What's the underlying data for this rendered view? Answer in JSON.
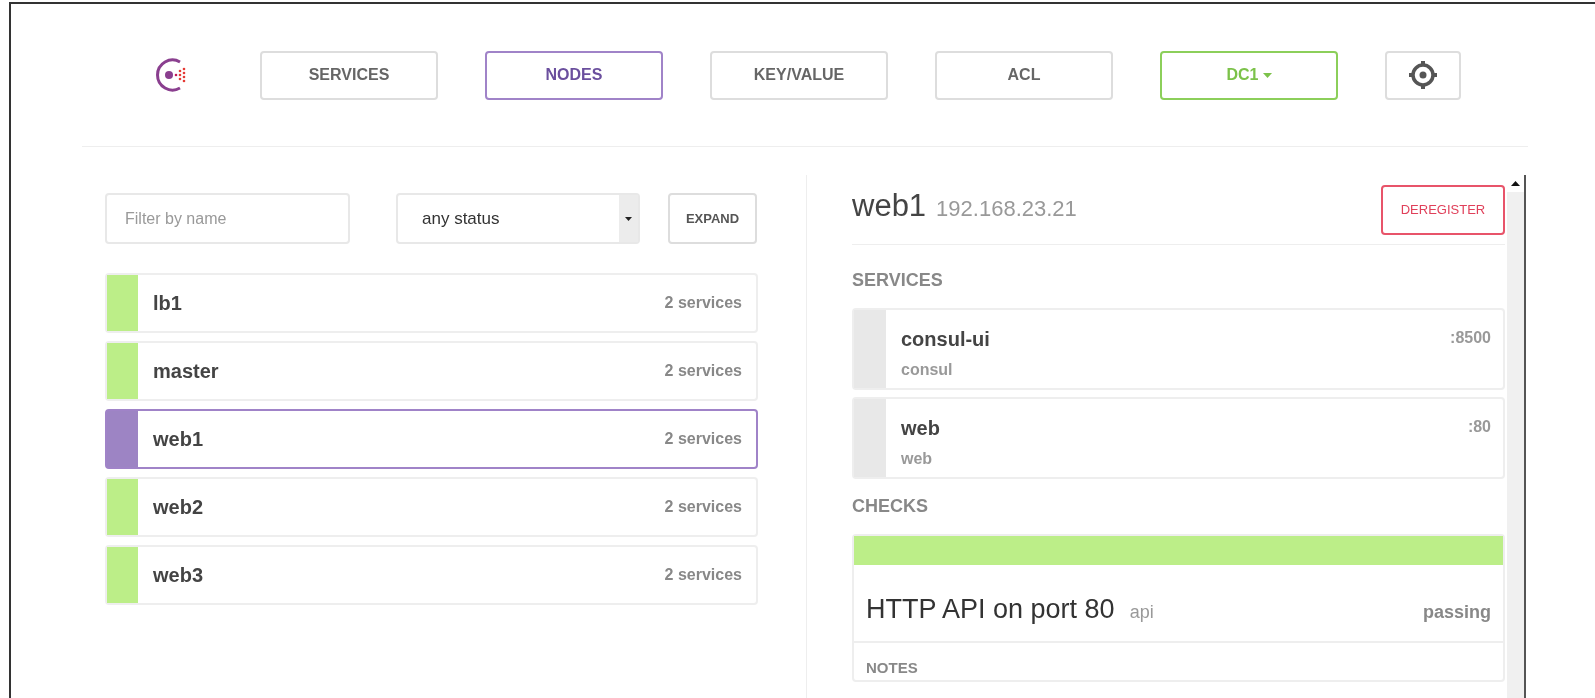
{
  "nav": {
    "items": [
      {
        "label": "SERVICES",
        "selected": false
      },
      {
        "label": "NODES",
        "selected": true
      },
      {
        "label": "KEY/VALUE",
        "selected": false
      },
      {
        "label": "ACL",
        "selected": false
      }
    ],
    "datacenter": "DC1"
  },
  "filters": {
    "name_placeholder": "Filter by name",
    "status": "any status",
    "expand": "EXPAND"
  },
  "nodes": [
    {
      "name": "lb1",
      "services": "2 services",
      "selected": false
    },
    {
      "name": "master",
      "services": "2 services",
      "selected": false
    },
    {
      "name": "web1",
      "services": "2 services",
      "selected": true
    },
    {
      "name": "web2",
      "services": "2 services",
      "selected": false
    },
    {
      "name": "web3",
      "services": "2 services",
      "selected": false
    }
  ],
  "detail": {
    "name": "web1",
    "address": "192.168.23.21",
    "deregister": "DEREGISTER",
    "services_heading": "SERVICES",
    "services": [
      {
        "name": "consul-ui",
        "tag": "consul",
        "port": ":8500"
      },
      {
        "name": "web",
        "tag": "web",
        "port": ":80"
      }
    ],
    "checks_heading": "CHECKS",
    "checks": [
      {
        "name": "HTTP API on port 80",
        "service": "api",
        "status": "passing",
        "color": "#bcee88",
        "notes_heading": "NOTES"
      }
    ]
  }
}
